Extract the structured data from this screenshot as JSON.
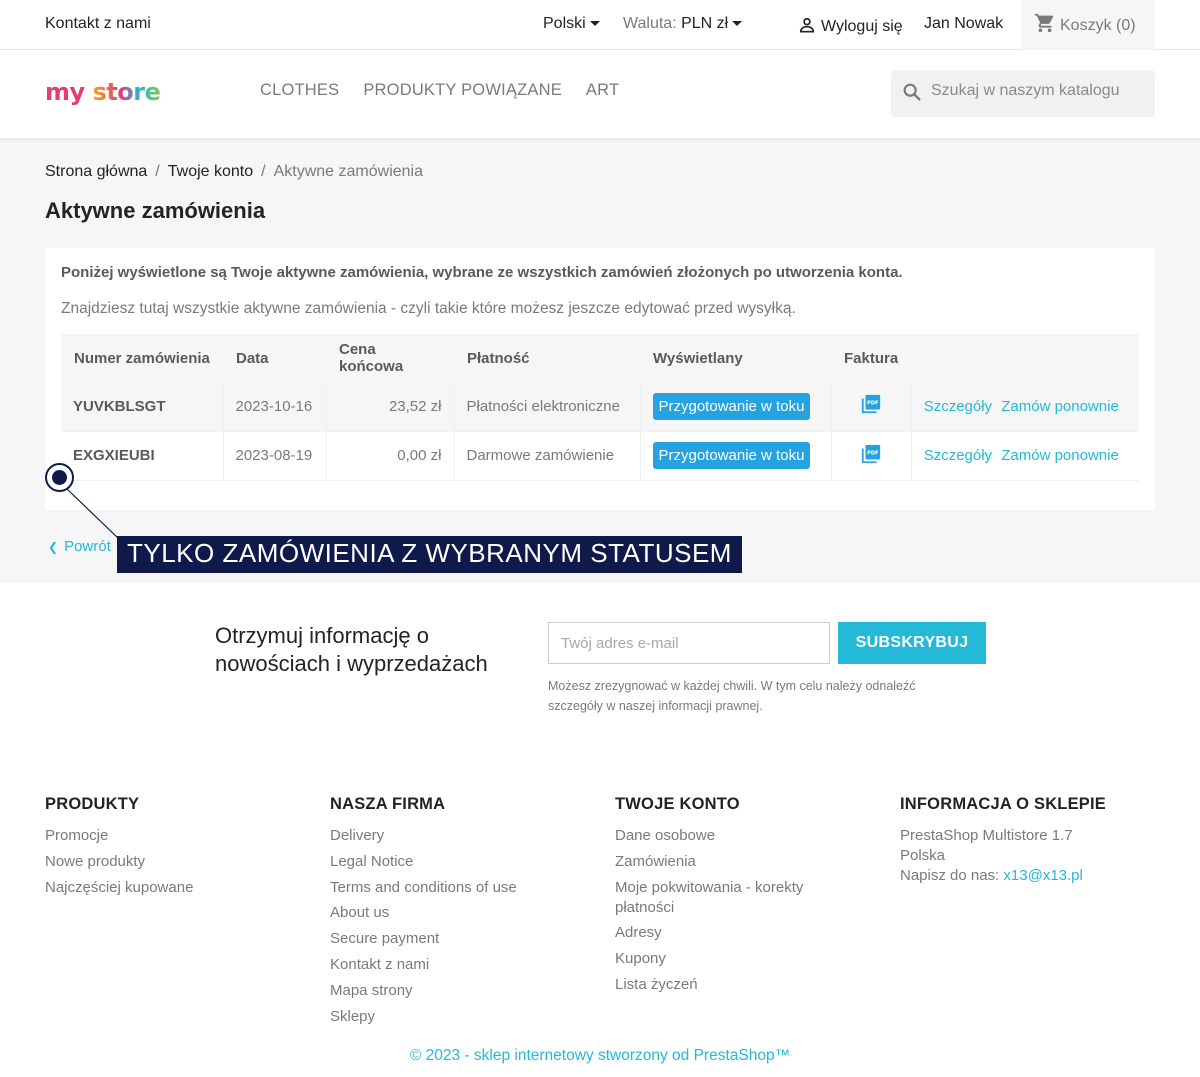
{
  "topbar": {
    "contact": "Kontakt z nami",
    "language": "Polski",
    "currency_label": "Waluta:",
    "currency_value": "PLN zł",
    "logout": "Wyloguj się",
    "user_name": "Jan Nowak",
    "cart": "Koszyk (0)"
  },
  "header": {
    "logo_word1": "my",
    "logo_word2": "store",
    "menu": [
      "CLOTHES",
      "PRODUKTY POWIĄZANE",
      "ART"
    ],
    "search_placeholder": "Szukaj w naszym katalogu"
  },
  "breadcrumb": {
    "home": "Strona główna",
    "account": "Twoje konto",
    "current": "Aktywne zamówienia",
    "separator": "/"
  },
  "page_title": "Aktywne zamówienia",
  "intro": {
    "line1": "Poniżej wyświetlone są Twoje aktywne zamówienia, wybrane ze wszystkich zamówień złożonych po utworzenia konta.",
    "line2": "Znajdziesz tutaj wszystkie aktywne zamówienia - czyli takie które możesz jeszcze edytować przed wysyłką."
  },
  "table": {
    "headers": [
      "Numer zamówienia",
      "Data",
      "Cena końcowa",
      "Płatność",
      "Wyświetlany",
      "Faktura"
    ],
    "rows": [
      {
        "ref": "YUVKBLSGT",
        "date": "2023-10-16",
        "price": "23,52 zł",
        "payment": "Płatności elektroniczne",
        "status": "Przygotowanie w toku",
        "details": "Szczegóły",
        "reorder": "Zamów ponownie"
      },
      {
        "ref": "EXGXIEUBI",
        "date": "2023-08-19",
        "price": "0,00 zł",
        "payment": "Darmowe zamówienie",
        "status": "Przygotowanie w toku",
        "details": "Szczegóły",
        "reorder": "Zamów ponownie"
      }
    ]
  },
  "back_link": "Powrót",
  "annotation": "TYLKO ZAMÓWIENIA Z WYBRANYM STATUSEM",
  "newsletter": {
    "title": "Otrzymuj informację o nowościach i wyprzedażach",
    "placeholder": "Twój adres e-mail",
    "button": "SUBSKRYBUJ",
    "note": "Możesz zrezygnować w każdej chwili. W tym celu należy odnaleźć szczegóły w naszej informacji prawnej."
  },
  "footer": {
    "products": {
      "title": "PRODUKTY",
      "items": [
        "Promocje",
        "Nowe produkty",
        "Najczęściej kupowane"
      ]
    },
    "company": {
      "title": "NASZA FIRMA",
      "items": [
        "Delivery",
        "Legal Notice",
        "Terms and conditions of use",
        "About us",
        "Secure payment",
        "Kontakt z nami",
        "Mapa strony",
        "Sklepy"
      ]
    },
    "account": {
      "title": "TWOJE KONTO",
      "items": [
        "Dane osobowe",
        "Zamówienia",
        "Moje pokwitowania - korekty płatności",
        "Adresy",
        "Kupony",
        "Lista życzeń"
      ]
    },
    "store": {
      "title": "INFORMACJA O SKLEPIE",
      "line1": "PrestaShop Multistore 1.7",
      "line2": "Polska",
      "email_label": "Napisz do nas:",
      "email": "x13@x13.pl"
    },
    "copyright": "© 2023 - sklep internetowy stworzony od PrestaShop™"
  },
  "colors": {
    "accent": "#24b9d7",
    "status_badge": "#25a3e0",
    "annotation": "#0f1a4a"
  }
}
